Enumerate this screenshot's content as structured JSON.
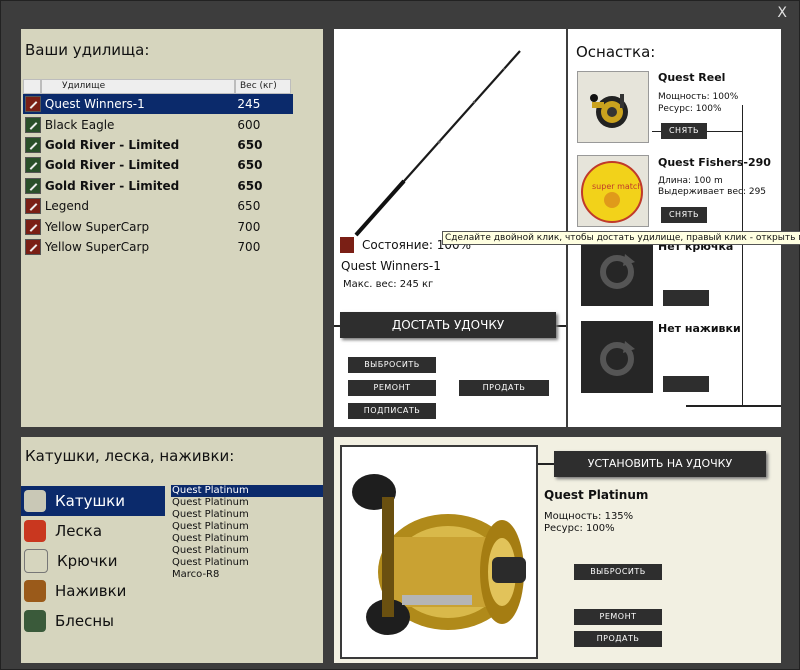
{
  "window": {
    "close_label": "X"
  },
  "rods": {
    "title": "Ваши удилища:",
    "col_name": "Удилище",
    "col_weight": "Вес (кг)",
    "rows": [
      {
        "name": "Quest Winners-1",
        "weight": "245"
      },
      {
        "name": "Black Eagle",
        "weight": "600"
      },
      {
        "name": "Gold River - Limited",
        "weight": "650"
      },
      {
        "name": "Gold River - Limited",
        "weight": "650"
      },
      {
        "name": "Gold River - Limited",
        "weight": "650"
      },
      {
        "name": "Legend",
        "weight": "650"
      },
      {
        "name": "Yellow SuperCarp",
        "weight": "700"
      },
      {
        "name": "Yellow SuperCarp",
        "weight": "700"
      }
    ]
  },
  "rod_detail": {
    "state_label": "Состояние: 100%",
    "name": "Quest Winners-1",
    "max_weight": "Макс. вес: 245 кг",
    "take_button": "ДОСТАТЬ УДОЧКУ",
    "drop_button": "ВЫБРОСИТЬ",
    "repair_button": "РЕМОНТ",
    "sell_button": "ПРОДАТЬ",
    "sign_button": "ПОДПИСАТЬ"
  },
  "tooltip": "Сделайте двойной клик, чтобы достать удилище, правый клик - открыть м",
  "tackle": {
    "title": "Оснастка:",
    "reel_name": "Quest Reel",
    "reel_power": "Мощность: 100%",
    "reel_resource": "Ресурс: 100%",
    "reel_remove": "СНЯТЬ",
    "line_name": "Quest Fishers-290",
    "line_length": "Длина: 100 m",
    "line_holds": "Выдерживает вес: 295",
    "line_remove": "СНЯТЬ",
    "line_spool_text": "super match",
    "no_hook": "Нет крючка",
    "no_bait": "Нет наживки"
  },
  "inventory": {
    "title": "Катушки, леска, наживки:",
    "categories": [
      "Катушки",
      "Леска",
      "Крючки",
      "Наживки",
      "Блесны"
    ],
    "items": [
      "Quest Platinum",
      "Quest Platinum",
      "Quest Platinum",
      "Quest Platinum",
      "Quest Platinum",
      "Quest Platinum",
      "Quest Platinum",
      "Marco-R8"
    ]
  },
  "item_detail": {
    "install_button": "УСТАНОВИТЬ НА УДОЧКУ",
    "name": "Quest Platinum",
    "power": "Мощность: 135%",
    "resource": "Ресурс: 100%",
    "drop_button": "ВЫБРОСИТЬ",
    "repair_button": "РЕМОНТ",
    "sell_button": "ПРОДАТЬ"
  },
  "colors": {
    "selection": "#0b2a6b",
    "button": "#2e2e2e",
    "panel_tan": "#d6d5be",
    "panel_cream": "#f2f0e2",
    "frame": "#3d3d3d"
  }
}
